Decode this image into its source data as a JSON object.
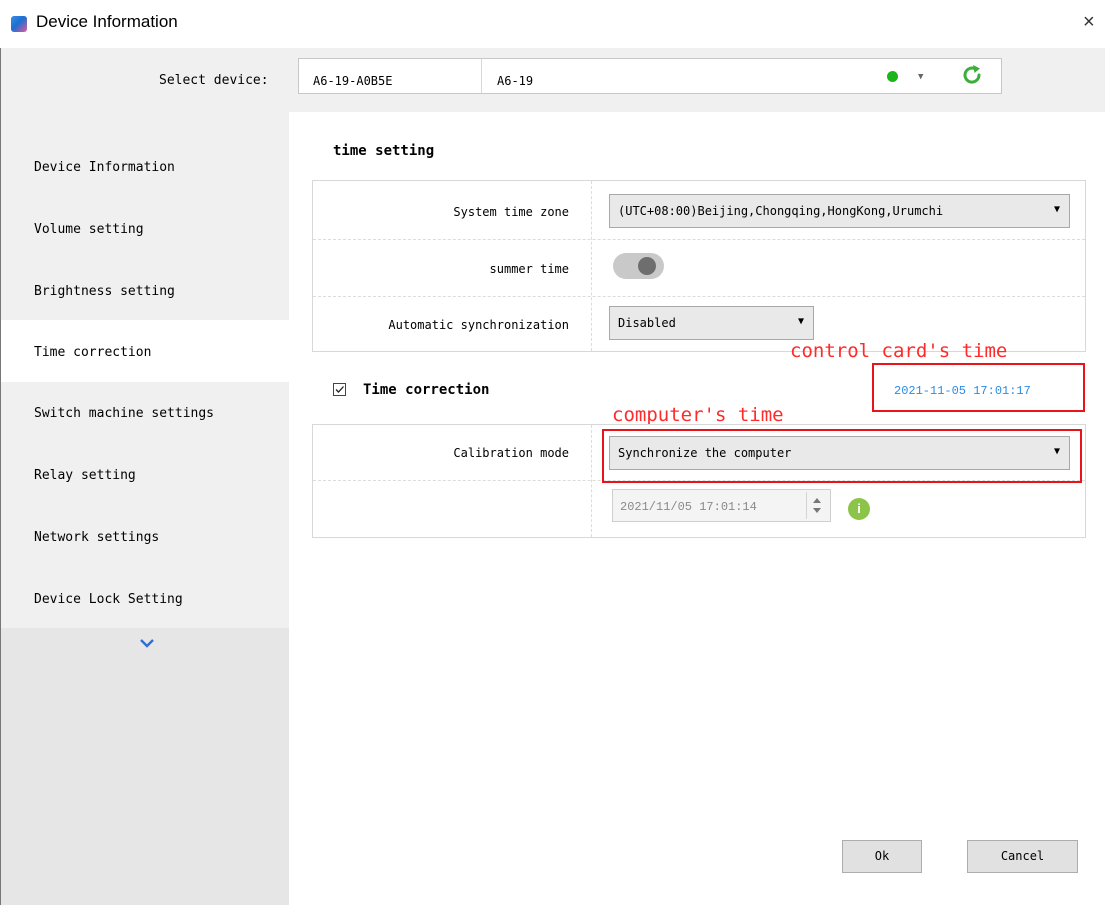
{
  "window": {
    "title": "Device Information",
    "close_glyph": "×"
  },
  "device_bar": {
    "label": "Select device:",
    "device_id": "A6-19-A0B5E",
    "device_name": "A6-19",
    "status_color": "#19b519",
    "dropdown_icon": "chevron-down-icon",
    "refresh_icon": "refresh-icon"
  },
  "sidebar": {
    "items": [
      {
        "label": "Device Information"
      },
      {
        "label": "Volume setting"
      },
      {
        "label": "Brightness setting"
      },
      {
        "label": "Time correction",
        "active": true
      },
      {
        "label": "Switch machine settings"
      },
      {
        "label": "Relay setting"
      },
      {
        "label": "Network settings"
      },
      {
        "label": "Device Lock Setting"
      }
    ],
    "more_icon": "chevron-down-icon"
  },
  "time_setting": {
    "title": "time setting",
    "rows": {
      "timezone_label": "System time zone",
      "timezone_value": "(UTC+08:00)Beijing,Chongqing,HongKong,Urumchi",
      "summer_label": "summer time",
      "summer_enabled": false,
      "autosync_label": "Automatic synchronization",
      "autosync_value": "Disabled"
    }
  },
  "time_correction": {
    "checkbox_label": "Time correction",
    "checked": true,
    "control_card_time": "2021-11-05 17:01:17",
    "calibration_label": "Calibration mode",
    "calibration_value": "Synchronize the computer",
    "computer_time": "2021/11/05 17:01:14"
  },
  "annotations": {
    "control_card": "control card's time",
    "computer": "computer's time",
    "color": "#e8141a"
  },
  "buttons": {
    "ok": "Ok",
    "cancel": "Cancel"
  }
}
